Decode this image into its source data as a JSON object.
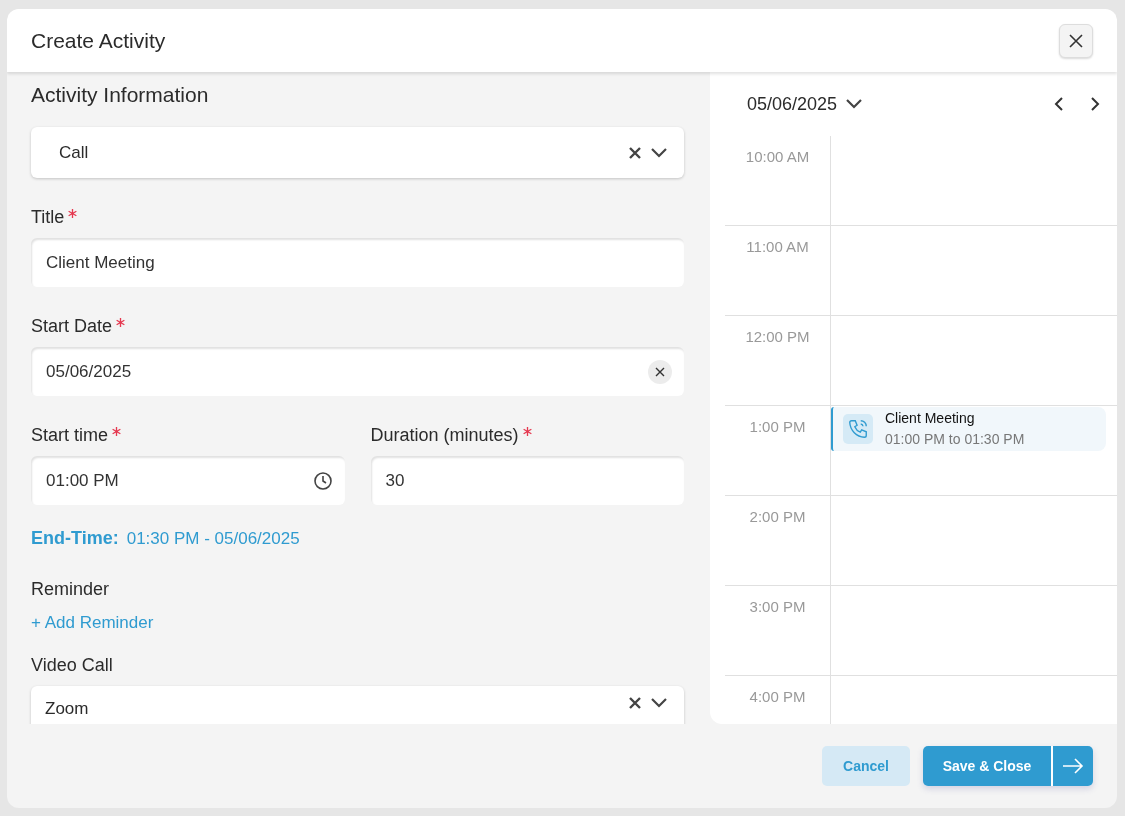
{
  "dialog": {
    "title": "Create Activity"
  },
  "form": {
    "heading": "Activity Information",
    "activity_type": {
      "value": "Call"
    },
    "title": {
      "label": "Title",
      "required": true,
      "value": "Client Meeting"
    },
    "start_date": {
      "label": "Start Date",
      "required": true,
      "value": "05/06/2025"
    },
    "start_time": {
      "label": "Start time",
      "required": true,
      "value": "01:00 PM"
    },
    "duration": {
      "label": "Duration (minutes)",
      "required": true,
      "value": "30"
    },
    "end_time": {
      "label": "End-Time:",
      "value": "01:30 PM - 05/06/2025"
    },
    "reminder": {
      "label": "Reminder",
      "add_link": "+ Add Reminder"
    },
    "video_call": {
      "label": "Video Call",
      "value": "Zoom"
    }
  },
  "calendar": {
    "date": "05/06/2025",
    "slots": [
      {
        "time": "10:00 AM"
      },
      {
        "time": "11:00 AM"
      },
      {
        "time": "12:00 PM"
      },
      {
        "time": "1:00 PM",
        "event": {
          "kind": "call",
          "title": "Client Meeting",
          "time": "01:00 PM to 01:30 PM"
        }
      },
      {
        "time": "2:00 PM"
      },
      {
        "time": "3:00 PM"
      },
      {
        "time": "4:00 PM"
      }
    ]
  },
  "footer": {
    "cancel": "Cancel",
    "save": "Save & Close"
  }
}
